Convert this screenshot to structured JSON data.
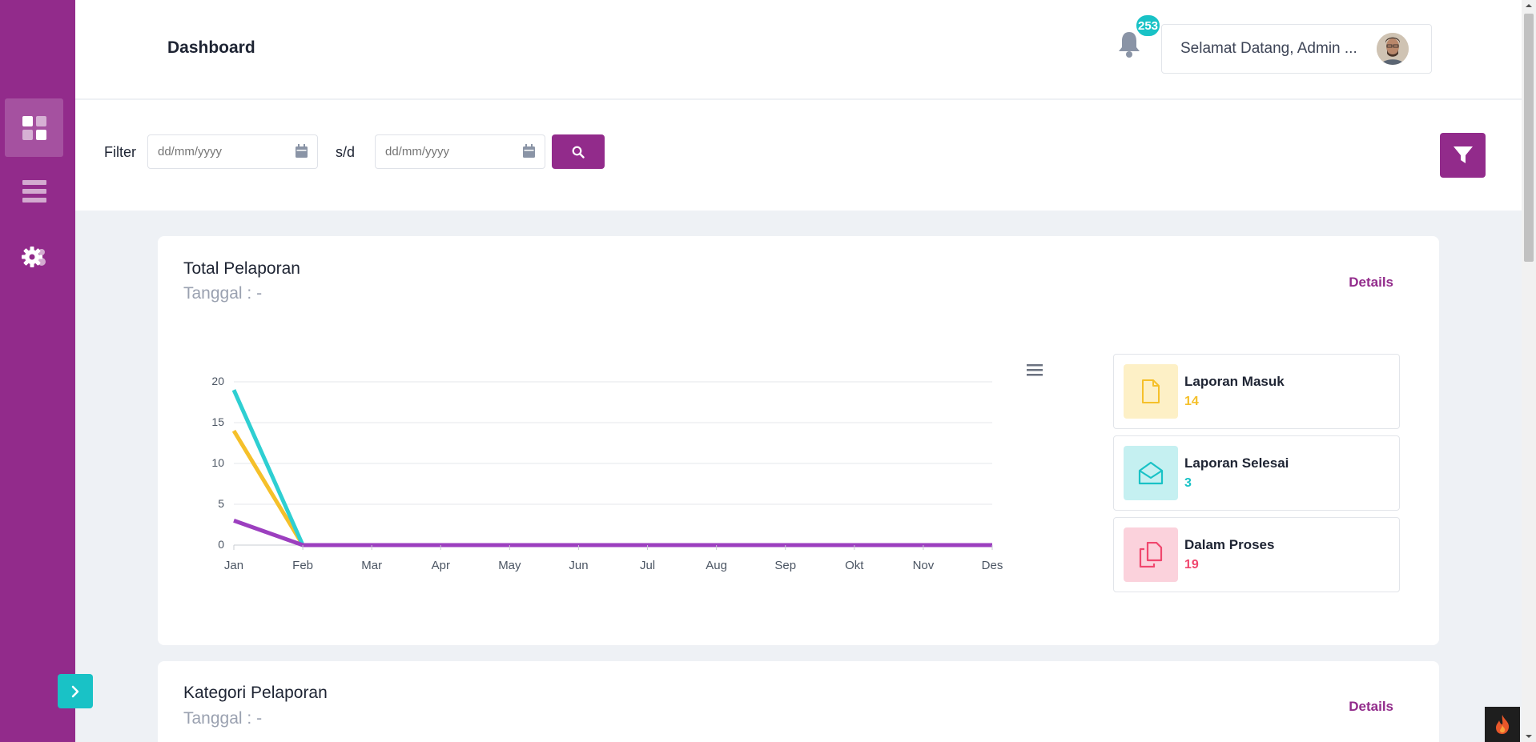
{
  "header": {
    "title": "Dashboard",
    "notification_count": "253",
    "welcome_text": "Selamat Datang, Admin ..."
  },
  "filter": {
    "label": "Filter",
    "separator": "s/d",
    "start_placeholder": "dd/mm/yyyy",
    "end_placeholder": "dd/mm/yyyy"
  },
  "cards": [
    {
      "title": "Total Pelaporan",
      "subtitle": "Tanggal : -",
      "details_label": "Details"
    },
    {
      "title": "Kategori Pelaporan",
      "subtitle": "Tanggal : -",
      "details_label": "Details"
    }
  ],
  "stats": [
    {
      "label": "Laporan Masuk",
      "value": "14",
      "color": "#f5c02a",
      "bg": "#fdf0c6",
      "icon": "file-icon"
    },
    {
      "label": "Laporan Selesai",
      "value": "3",
      "color": "#19c2c6",
      "bg": "#c5f0f1",
      "icon": "envelope-open-icon"
    },
    {
      "label": "Dalam Proses",
      "value": "19",
      "color": "#f0476e",
      "bg": "#fbd2dc",
      "icon": "copy-icon"
    }
  ],
  "colors": {
    "primary": "#922b8b",
    "accent": "#19c2c6"
  },
  "chart_data": {
    "type": "line",
    "title": "",
    "xlabel": "",
    "ylabel": "",
    "categories": [
      "Jan",
      "Feb",
      "Mar",
      "Apr",
      "May",
      "Jun",
      "Jul",
      "Aug",
      "Sep",
      "Okt",
      "Nov",
      "Des"
    ],
    "ylim": [
      0,
      20
    ],
    "yticks": [
      0,
      5,
      10,
      15,
      20
    ],
    "grid": true,
    "legend": "none",
    "series": [
      {
        "color": "#f5c02a",
        "values": [
          14,
          0,
          0,
          0,
          0,
          0,
          0,
          0,
          0,
          0,
          0,
          0
        ]
      },
      {
        "color": "#2ecfd2",
        "values": [
          19,
          0,
          0,
          0,
          0,
          0,
          0,
          0,
          0,
          0,
          0,
          0
        ]
      },
      {
        "color": "#9c3fbf",
        "values": [
          3,
          0,
          0,
          0,
          0,
          0,
          0,
          0,
          0,
          0,
          0,
          0
        ]
      }
    ]
  }
}
